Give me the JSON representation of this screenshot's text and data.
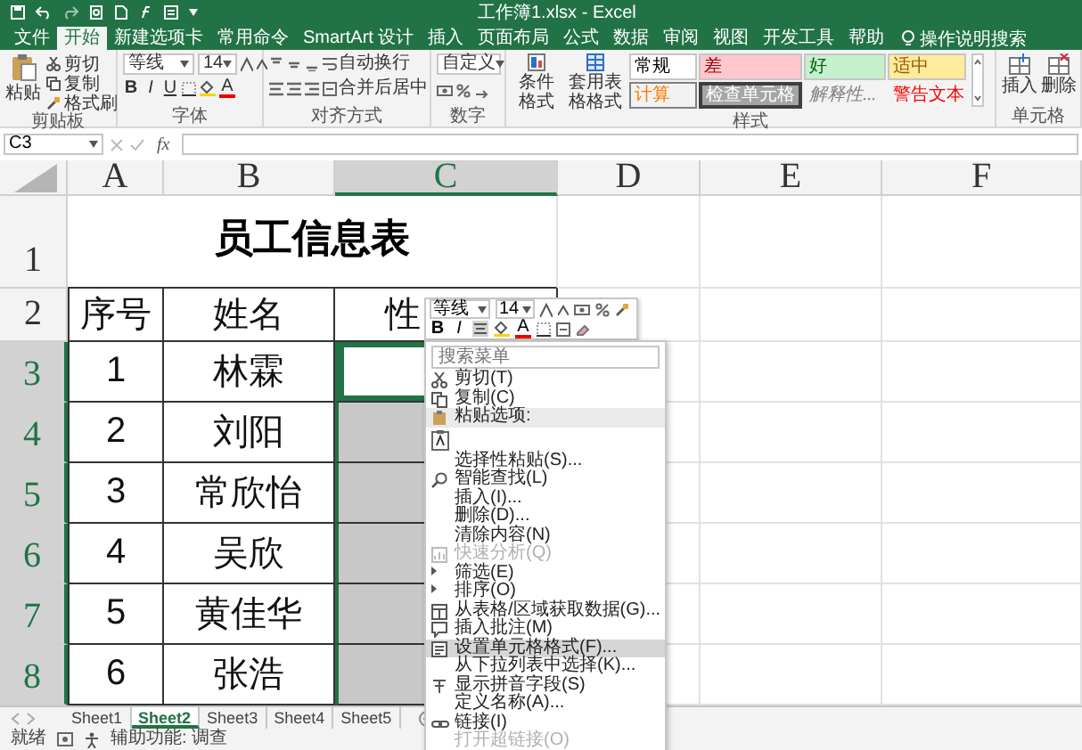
{
  "window": {
    "title": "工作簿1.xlsx - Excel"
  },
  "ribbon_tabs": [
    {
      "label": "文件",
      "selected": false
    },
    {
      "label": "开始",
      "selected": true
    },
    {
      "label": "新建选项卡",
      "selected": false
    },
    {
      "label": "常用命令",
      "selected": false
    },
    {
      "label": "SmartArt 设计",
      "selected": false
    },
    {
      "label": "插入",
      "selected": false
    },
    {
      "label": "页面布局",
      "selected": false
    },
    {
      "label": "公式",
      "selected": false
    },
    {
      "label": "数据",
      "selected": false
    },
    {
      "label": "审阅",
      "selected": false
    },
    {
      "label": "视图",
      "selected": false
    },
    {
      "label": "开发工具",
      "selected": false
    },
    {
      "label": "帮助",
      "selected": false
    }
  ],
  "tell_me": "操作说明搜索",
  "ribbon": {
    "clipboard": {
      "label": "剪贴板",
      "paste": "粘贴",
      "cut": "剪切",
      "copy": "复制",
      "format_painter": "格式刷"
    },
    "font": {
      "label": "字体",
      "font_name": "等线",
      "font_size": "14",
      "buttons": [
        "B",
        "I",
        "U"
      ],
      "font_color": "A"
    },
    "alignment": {
      "label": "对齐方式",
      "wrap_text": "自动换行",
      "merge_center": "合并后居中"
    },
    "number": {
      "label": "数字",
      "format": "自定义"
    },
    "styles": {
      "label": "样式",
      "conditional_formatting": "条件格式",
      "format_as_table": "套用表格格式",
      "gallery": [
        {
          "label": "常规",
          "kind": "normal"
        },
        {
          "label": "差",
          "kind": "bad"
        },
        {
          "label": "好",
          "kind": "good"
        },
        {
          "label": "适中",
          "kind": "neutral"
        },
        {
          "label": "计算",
          "kind": "calculation"
        },
        {
          "label": "检查单元格",
          "kind": "check"
        },
        {
          "label": "解释性...",
          "kind": "explanatory"
        },
        {
          "label": "警告文本",
          "kind": "warning"
        }
      ]
    },
    "cells": {
      "label": "单元格",
      "insert": "插入",
      "delete": "删除"
    }
  },
  "formula_bar": {
    "name_box": "C3",
    "fx": "fx"
  },
  "columns": [
    {
      "label": "A",
      "selected": false
    },
    {
      "label": "B",
      "selected": false
    },
    {
      "label": "C",
      "selected": true
    },
    {
      "label": "D",
      "selected": false
    },
    {
      "label": "E",
      "selected": false
    },
    {
      "label": "F",
      "selected": false
    }
  ],
  "row_headers": [
    {
      "label": "1",
      "selected": false
    },
    {
      "label": "2",
      "selected": false
    },
    {
      "label": "3",
      "selected": true
    },
    {
      "label": "4",
      "selected": true
    },
    {
      "label": "5",
      "selected": true
    },
    {
      "label": "6",
      "selected": true
    },
    {
      "label": "7",
      "selected": true
    },
    {
      "label": "8",
      "selected": true
    }
  ],
  "sheet": {
    "title": "员工信息表",
    "header": [
      "序号",
      "姓名",
      "性"
    ],
    "rows": [
      {
        "cells": [
          "1",
          "林霖"
        ],
        "selected": true
      },
      {
        "cells": [
          "2",
          "刘阳"
        ],
        "selected": true
      },
      {
        "cells": [
          "3",
          "常欣怡"
        ],
        "selected": true
      },
      {
        "cells": [
          "4",
          "吴欣"
        ],
        "selected": true
      },
      {
        "cells": [
          "5",
          "黄佳华"
        ],
        "selected": true
      },
      {
        "cells": [
          "6",
          "张浩"
        ],
        "selected": true
      }
    ]
  },
  "sheet_tabs": [
    {
      "label": "Sheet1",
      "selected": false
    },
    {
      "label": "Sheet2",
      "selected": true
    },
    {
      "label": "Sheet3",
      "selected": false
    },
    {
      "label": "Sheet4",
      "selected": false
    },
    {
      "label": "Sheet5",
      "selected": false
    }
  ],
  "status_bar": {
    "ready": "就绪",
    "accessibility": "辅助功能: 调查"
  },
  "mini_toolbar": {
    "font_name": "等线",
    "font_size": "14",
    "bold": "B",
    "italic": "I",
    "font_color": "A"
  },
  "context_menu": {
    "search_placeholder": "搜索菜单",
    "items": [
      {
        "label": "剪切(T)",
        "kind": "cut",
        "selected": false,
        "disabled": false
      },
      {
        "label": "复制(C)",
        "kind": "copy",
        "selected": false,
        "disabled": false
      },
      {
        "label": "粘贴选项:",
        "kind": "heading",
        "selected": false,
        "disabled": false
      },
      {
        "kind": "pasteoption",
        "selected": false,
        "disabled": false
      },
      {
        "label": "选择性粘贴(S)...",
        "kind": "plain",
        "selected": false,
        "disabled": false
      },
      {
        "label": "智能查找(L)",
        "kind": "lookup",
        "selected": false,
        "disabled": false
      },
      {
        "label": "插入(I)...",
        "kind": "plain",
        "selected": false,
        "disabled": false
      },
      {
        "label": "删除(D)...",
        "kind": "plain",
        "selected": false,
        "disabled": false
      },
      {
        "label": "清除内容(N)",
        "kind": "plain",
        "selected": false,
        "disabled": false
      },
      {
        "label": "快速分析(Q)",
        "kind": "analysis",
        "selected": false,
        "disabled": true
      },
      {
        "label": "筛选(E)",
        "kind": "submenu",
        "selected": false,
        "disabled": false
      },
      {
        "label": "排序(O)",
        "kind": "submenu",
        "selected": false,
        "disabled": false
      },
      {
        "label": "从表格/区域获取数据(G)...",
        "kind": "table",
        "selected": false,
        "disabled": false
      },
      {
        "label": "插入批注(M)",
        "kind": "comment",
        "selected": false,
        "disabled": false
      },
      {
        "label": "设置单元格格式(F)...",
        "kind": "format",
        "selected": true,
        "disabled": false
      },
      {
        "label": "从下拉列表中选择(K)...",
        "kind": "plain",
        "selected": false,
        "disabled": false
      },
      {
        "label": "显示拼音字段(S)",
        "kind": "phonetic",
        "selected": false,
        "disabled": false
      },
      {
        "label": "定义名称(A)...",
        "kind": "plain",
        "selected": false,
        "disabled": false
      },
      {
        "label": "链接(I)",
        "kind": "link",
        "selected": false,
        "disabled": false
      },
      {
        "label": "打开超链接(O)",
        "kind": "plain",
        "selected": false,
        "disabled": true
      }
    ]
  }
}
